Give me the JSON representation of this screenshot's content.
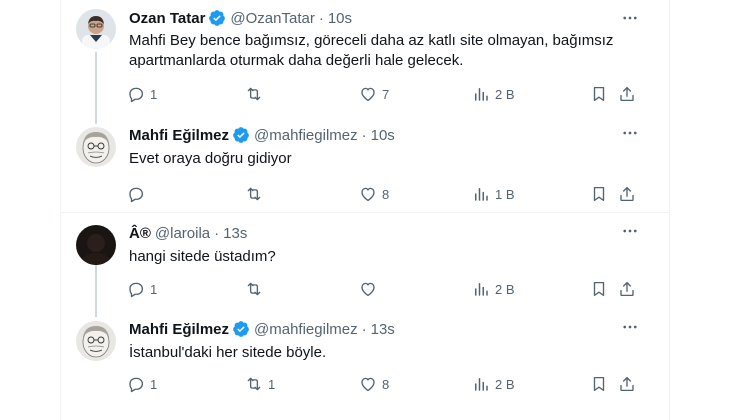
{
  "tweets": [
    {
      "name": "Ozan Tatar",
      "handle": "@OzanTatar",
      "sep": "·",
      "time": "10s",
      "text": "Mahfi Bey bence bağımsız, göreceli daha az katlı site olmayan, bağımsız apartmanlarda oturmak daha değerli hale gelecek.",
      "replies": "1",
      "retweets": "",
      "likes": "7",
      "views": "2 B"
    },
    {
      "name": "Mahfi Eğilmez",
      "handle": "@mahfiegilmez",
      "sep": "·",
      "time": "10s",
      "text": "Evet oraya doğru gidiyor",
      "replies": "",
      "retweets": "",
      "likes": "8",
      "views": "1 B"
    },
    {
      "name": "Â®",
      "handle": "@laroila",
      "sep": "·",
      "time": "13s",
      "text": "hangi sitede üstadım?",
      "replies": "1",
      "retweets": "",
      "likes": "",
      "views": "2 B"
    },
    {
      "name": "Mahfi Eğilmez",
      "handle": "@mahfiegilmez",
      "sep": "·",
      "time": "13s",
      "text": "İstanbul'daki her sitede böyle.",
      "replies": "1",
      "retweets": "1",
      "likes": "8",
      "views": "2 B"
    }
  ],
  "colors": {
    "verified": "#1d9bf0",
    "icon": "#536471",
    "text": "#0f1419",
    "thread_line": "#cfd9de"
  }
}
